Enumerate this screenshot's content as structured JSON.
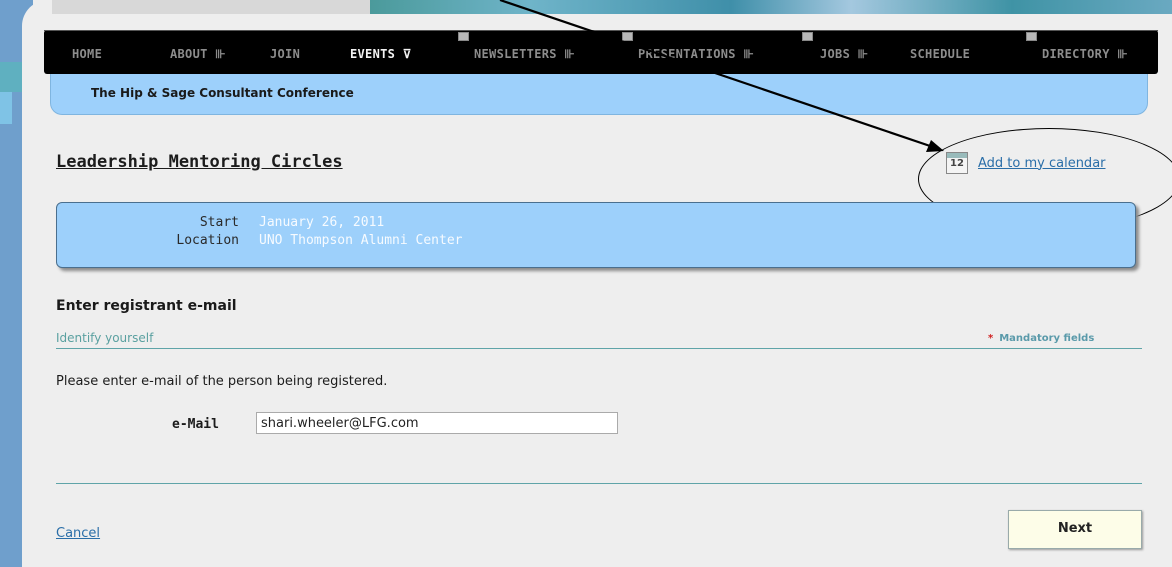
{
  "nav": {
    "items": [
      {
        "label": "HOME"
      },
      {
        "label": "ABOUT ⊪"
      },
      {
        "label": "JOIN"
      },
      {
        "label": "EVENTS ⊽"
      },
      {
        "label": "NEWSLETTERS ⊪"
      },
      {
        "label": "PRESENTATIONS ⊪"
      },
      {
        "label": "JOBS ⊪"
      },
      {
        "label": "SCHEDULE"
      },
      {
        "label": "DIRECTORY ⊪"
      }
    ],
    "active": "EVENTS"
  },
  "subnav": {
    "label": "The Hip & Sage Consultant Conference"
  },
  "event": {
    "title": "Leadership Mentoring Circles",
    "calendar_link": "Add to my calendar",
    "calendar_icon_text": "12",
    "start_label": "Start",
    "start_value": "January 26, 2011",
    "location_label": "Location",
    "location_value": "UNO Thompson Alumni Center"
  },
  "form": {
    "section_title": "Enter registrant e-mail",
    "subtitle": "Identify yourself",
    "mandatory_star": "*",
    "mandatory_label": "Mandatory fields",
    "instructions": "Please enter e-mail of the person being registered.",
    "email_label": "e-Mail",
    "email_value": "shari.wheeler@LFG.com"
  },
  "footer": {
    "cancel_label": "Cancel",
    "next_label": "Next"
  },
  "colors": {
    "accent_blue": "#9dd0fb",
    "link_blue": "#2a6ea8",
    "teal_rule": "#5fa4a8"
  }
}
